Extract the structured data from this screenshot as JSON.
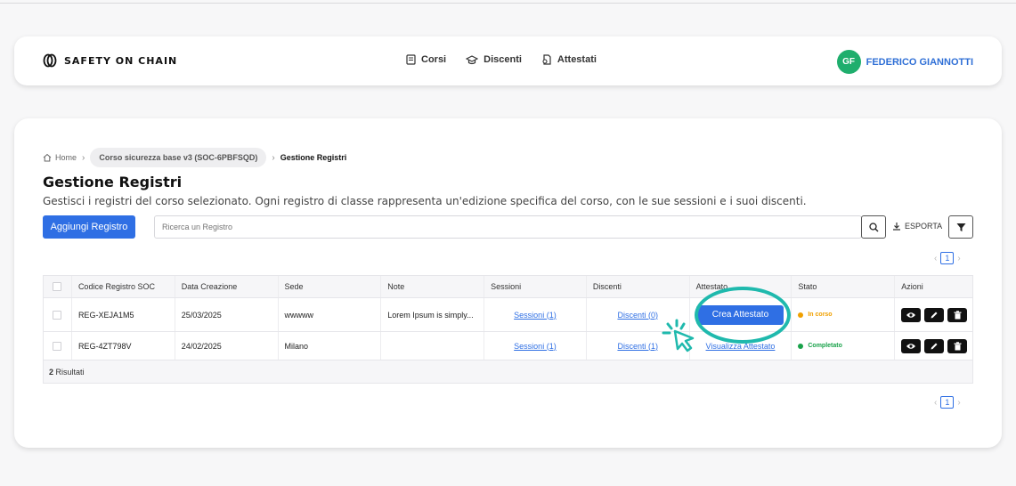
{
  "navbar": {
    "brand": "SAFETY ON CHAIN",
    "links": [
      {
        "label": "Corsi",
        "icon": "book-icon"
      },
      {
        "label": "Discenti",
        "icon": "graduation-cap-icon"
      },
      {
        "label": "Attestati",
        "icon": "certificate-icon"
      }
    ],
    "user": {
      "initials": "GF",
      "name": "FEDERICO GIANNOTTI",
      "avatar_color": "#1fae6d"
    }
  },
  "breadcrumb": {
    "home": "Home",
    "course": "Corso sicurezza base v3 (SOC-6PBFSQD)",
    "current": "Gestione Registri"
  },
  "page": {
    "title": "Gestione Registri",
    "subtitle": "Gestisci i registri del corso selezionato. Ogni registro di classe rappresenta un'edizione specifica del corso, con le sue sessioni e i suoi discenti."
  },
  "toolbar": {
    "add_label": "Aggiungi Registro",
    "search_placeholder": "Ricerca un Registro",
    "export_label": "ESPORTA"
  },
  "pagination": {
    "current_page": "1"
  },
  "table": {
    "columns": [
      "Codice Registro SOC",
      "Data Creazione",
      "Sede",
      "Note",
      "Sessioni",
      "Discenti",
      "Attestato",
      "Stato",
      "Azioni"
    ],
    "rows": [
      {
        "code": "REG-XEJA1M5",
        "date": "25/03/2025",
        "sede": "wwwww",
        "note": "Lorem Ipsum is simply...",
        "sessioni": "Sessioni (1)",
        "discenti": "Discenti (0)",
        "attestato": "Crea Attestato",
        "stato": "In corso",
        "stato_color": "#f0a000"
      },
      {
        "code": "REG-4ZT798V",
        "date": "24/02/2025",
        "sede": "Milano",
        "note": "",
        "sessioni": "Sessioni (1)",
        "discenti": "Discenti (1)",
        "attestato": "Visualizza Attestato",
        "stato": "Completato",
        "stato_color": "#19a24a"
      }
    ],
    "results_count": "2",
    "results_label": "Risultati"
  },
  "colors": {
    "primary": "#2f6fe4",
    "highlight": "#1fb9ad"
  }
}
